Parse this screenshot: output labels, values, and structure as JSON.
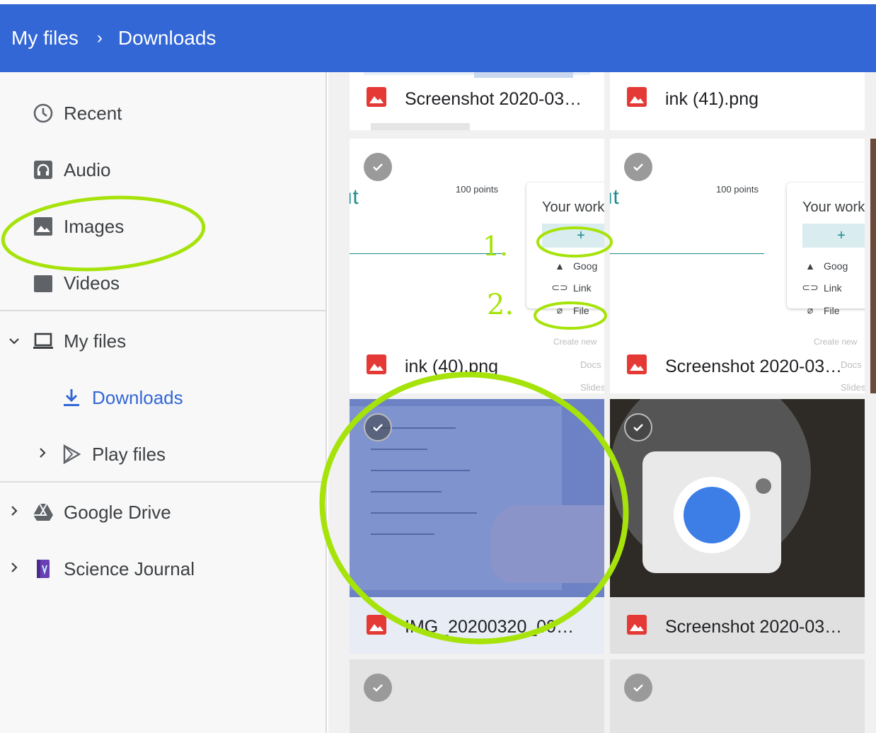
{
  "breadcrumb": {
    "root": "My files",
    "separator": "›",
    "current": "Downloads"
  },
  "sidebar": {
    "items": [
      {
        "label": "Recent",
        "icon": "clock-icon"
      },
      {
        "label": "Audio",
        "icon": "headphones-icon"
      },
      {
        "label": "Images",
        "icon": "image-icon"
      },
      {
        "label": "Videos",
        "icon": "video-icon"
      }
    ],
    "my_files": {
      "label": "My files",
      "icon": "laptop-icon"
    },
    "downloads": {
      "label": "Downloads",
      "icon": "download-icon"
    },
    "play_files": {
      "label": "Play files",
      "icon": "play-store-icon"
    },
    "google_drive": {
      "label": "Google Drive",
      "icon": "google-drive-icon"
    },
    "science_journal": {
      "label": "Science Journal",
      "icon": "science-journal-icon"
    }
  },
  "files": [
    {
      "name": "Screenshot 2020-03…"
    },
    {
      "name": "ink (41).png"
    },
    {
      "name": "ink (40).png"
    },
    {
      "name": "Screenshot 2020-03…"
    },
    {
      "name": "IMG_20200320_09…"
    },
    {
      "name": "Screenshot 2020-03…"
    }
  ],
  "preview": {
    "points": "100 points",
    "your_work": "Your work",
    "plus": "+",
    "menu": [
      "Goog",
      "Link",
      "File"
    ],
    "create_new": "Create new",
    "docs": "Docs",
    "slides": "Slides",
    "annot_1": "1.",
    "annot_2": "2."
  },
  "colors": {
    "header": "#3367d6",
    "accent": "#3367d6",
    "highlight": "#a6e30a",
    "image_icon": "#e53935"
  }
}
